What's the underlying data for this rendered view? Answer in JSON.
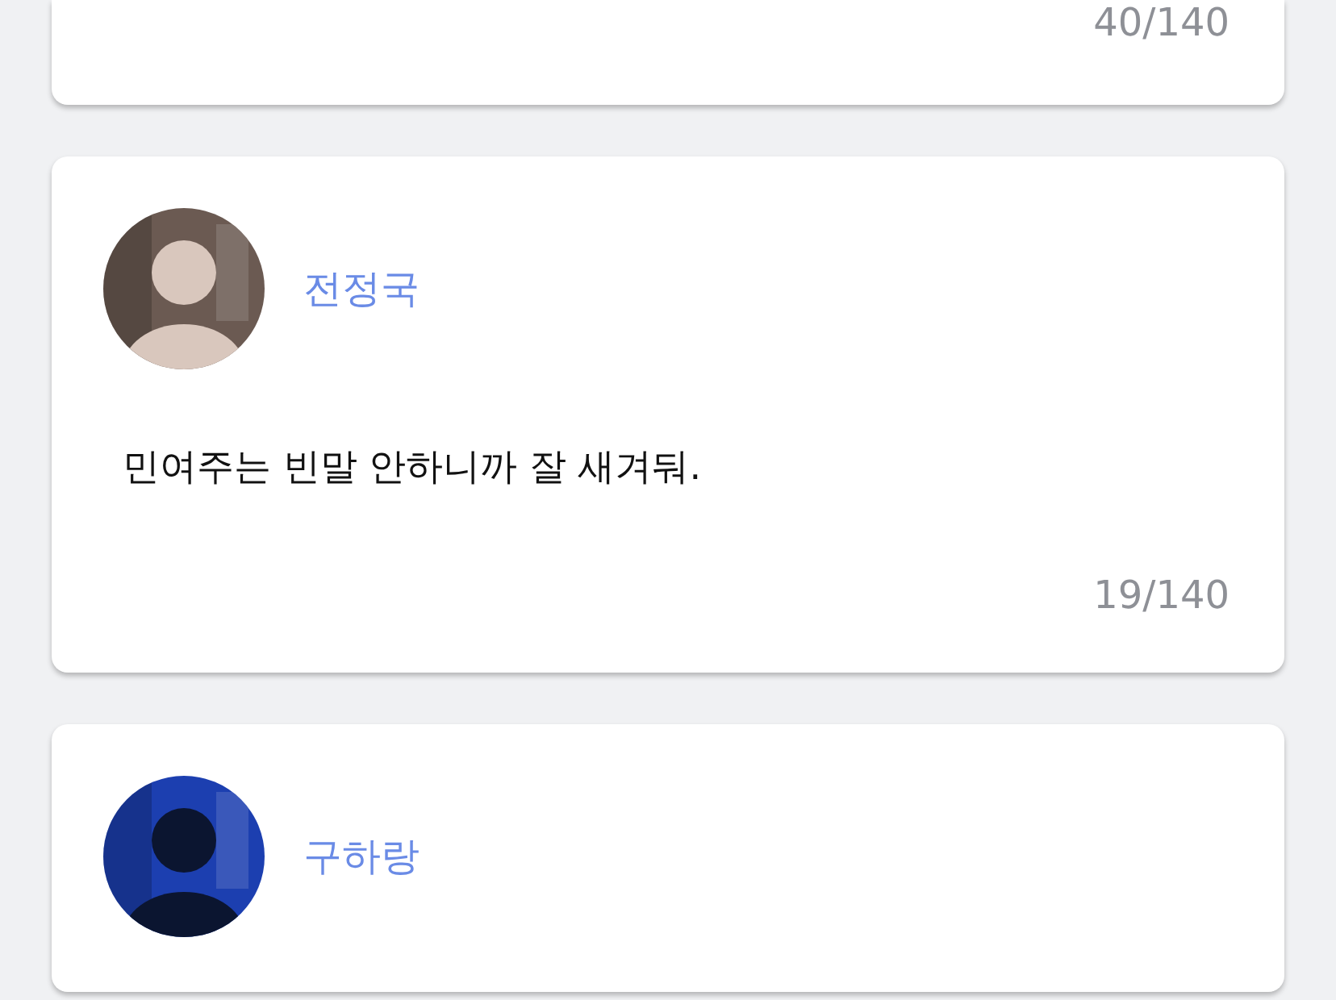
{
  "posts": [
    {
      "counter": "40/140"
    },
    {
      "author": "전정국",
      "message": "민여주는 빈말 안하니까 잘 새겨둬.",
      "counter": "19/140"
    },
    {
      "author": "구하랑"
    }
  ]
}
